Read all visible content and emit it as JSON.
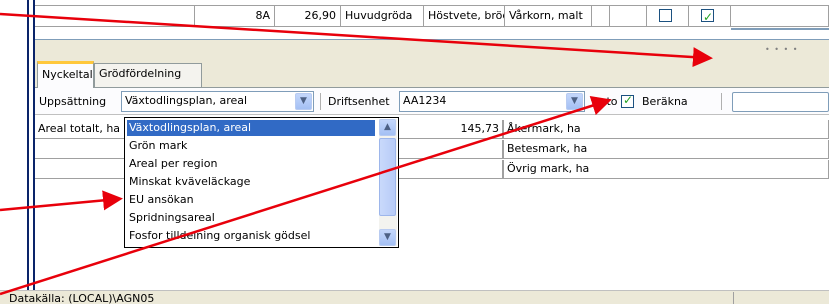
{
  "grid_row": {
    "code": "8A",
    "area": "26,90",
    "type": "Huvudgröda",
    "crop": "Höstvete, bröd",
    "next_crop": "Vårkorn, malt",
    "check1": false,
    "check2": true
  },
  "tabs": [
    {
      "label": "Nyckeltal",
      "active": true
    },
    {
      "label": "Grödfördelning",
      "active": false
    }
  ],
  "toolbar": {
    "setup_label": "Uppsättning",
    "setup_value": "Växtodlingsplan, areal",
    "unit_label": "Driftsenhet",
    "unit_value": "AA1234",
    "auto_label": "Auto",
    "auto_checked": true,
    "calc_label": "Beräkna"
  },
  "table": {
    "rows": [
      {
        "label": "Areal totalt, ha",
        "value": "145,73",
        "right": "Åkermark, ha"
      },
      {
        "label": "",
        "value": "",
        "right": "Betesmark, ha"
      },
      {
        "label": "",
        "value": "",
        "right": "Övrig mark, ha"
      }
    ]
  },
  "dropdown": {
    "items": [
      "Växtodlingsplan, areal",
      "Grön mark",
      "Areal per region",
      "Minskat kväveläckage",
      "EU ansökan",
      "Spridningsareal",
      "Fosfor tilldelning organisk gödsel"
    ],
    "selected_index": 0
  },
  "status": {
    "text": "Datakälla: (LOCAL)\\AGN05"
  },
  "colors": {
    "annotation_arrow": "#e8000b",
    "selection": "#316ac5",
    "tab_accent": "#ffc83c"
  }
}
